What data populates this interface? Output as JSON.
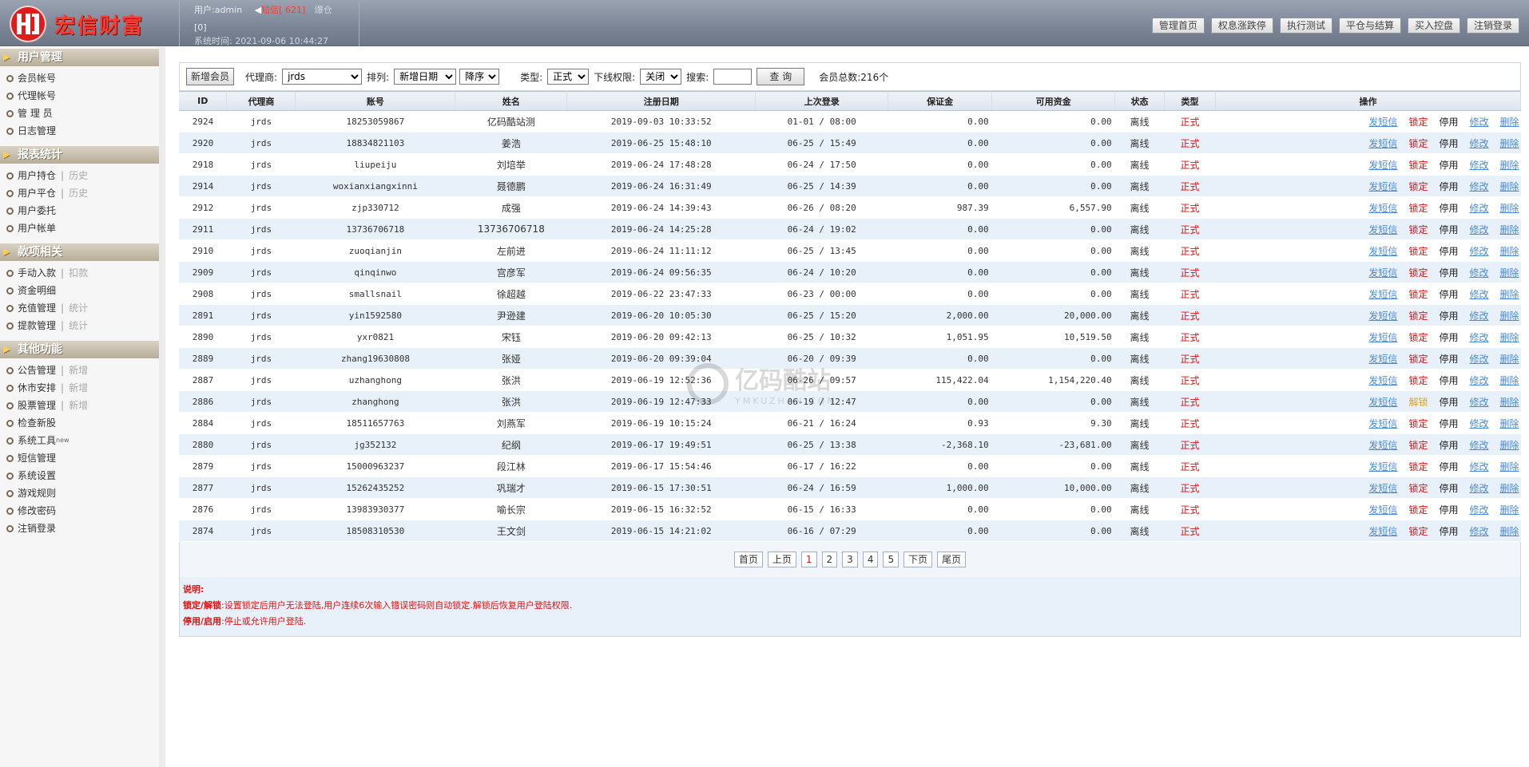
{
  "header": {
    "brand": "宏信财富",
    "user_label": "用户:admin",
    "sms_label": "短信[ 621]",
    "sms_extra": "爆仓",
    "bracket": "[0]",
    "time_label": "系统时间: 2021-09-06 10:44:27",
    "nav": [
      "管理首页",
      "权息涨跌停",
      "执行测试",
      "平仓与结算",
      "买入控盘",
      "注销登录"
    ]
  },
  "sidebar": {
    "sections": [
      {
        "title": "用户管理",
        "items": [
          {
            "label": "会员帐号"
          },
          {
            "label": "代理帐号"
          },
          {
            "label": "管 理 员"
          },
          {
            "label": "日志管理"
          }
        ]
      },
      {
        "title": "报表统计",
        "items": [
          {
            "label": "用户持仓",
            "sub": "历史"
          },
          {
            "label": "用户平仓",
            "sub": "历史"
          },
          {
            "label": "用户委托"
          },
          {
            "label": "用户帐单"
          }
        ]
      },
      {
        "title": "款项相关",
        "items": [
          {
            "label": "手动入款",
            "sub": "扣款"
          },
          {
            "label": "资金明细"
          },
          {
            "label": "充值管理",
            "sub": "统计"
          },
          {
            "label": "提款管理",
            "sub": "统计"
          }
        ]
      },
      {
        "title": "其他功能",
        "items": [
          {
            "label": "公告管理",
            "sub": "新增"
          },
          {
            "label": "休市安排",
            "sub": "新增"
          },
          {
            "label": "股票管理",
            "sub": "新增"
          },
          {
            "label": "检查新股"
          },
          {
            "label": "系统工具",
            "sup": "new"
          },
          {
            "label": "短信管理"
          },
          {
            "label": "系统设置"
          },
          {
            "label": "游戏规则"
          },
          {
            "label": "修改密码"
          },
          {
            "label": "注销登录"
          }
        ]
      }
    ]
  },
  "filters": {
    "add_button": "新增会员",
    "agent_label": "代理商:",
    "agent_value": "jrds",
    "sort_label": "排列:",
    "sort_value": "新增日期",
    "order_value": "降序",
    "type_label": "类型:",
    "type_value": "正式",
    "offline_label": "下线权限:",
    "offline_value": "关闭",
    "search_label": "搜索:",
    "search_value": "",
    "query_button": "查 询",
    "total": "会员总数:216个"
  },
  "table": {
    "headers": [
      "ID",
      "代理商",
      "账号",
      "姓名",
      "注册日期",
      "上次登录",
      "保证金",
      "可用资金",
      "状态",
      "类型",
      "操作"
    ],
    "ops": {
      "sms": "发短信",
      "lock": "锁定",
      "unlock": "解锁",
      "stop": "停用",
      "edit": "修改",
      "del": "删除"
    },
    "rows": [
      [
        "2924",
        "jrds",
        "18253059867",
        "亿码酷站测",
        "2019-09-03 10:33:52",
        "01-01 / 08:00",
        "0.00",
        "0.00",
        "离线",
        "正式",
        "lock"
      ],
      [
        "2920",
        "jrds",
        "18834821103",
        "姜浩",
        "2019-06-25 15:48:10",
        "06-25 / 15:49",
        "0.00",
        "0.00",
        "离线",
        "正式",
        "lock"
      ],
      [
        "2918",
        "jrds",
        "liupeiju",
        "刘培举",
        "2019-06-24 17:48:28",
        "06-24 / 17:50",
        "0.00",
        "0.00",
        "离线",
        "正式",
        "lock"
      ],
      [
        "2914",
        "jrds",
        "woxianxiangxinni",
        "聂德鹏",
        "2019-06-24 16:31:49",
        "06-25 / 14:39",
        "0.00",
        "0.00",
        "离线",
        "正式",
        "lock"
      ],
      [
        "2912",
        "jrds",
        "zjp330712",
        "成强",
        "2019-06-24 14:39:43",
        "06-26 / 08:20",
        "987.39",
        "6,557.90",
        "离线",
        "正式",
        "lock"
      ],
      [
        "2911",
        "jrds",
        "13736706718",
        "13736706718",
        "2019-06-24 14:25:28",
        "06-24 / 19:02",
        "0.00",
        "0.00",
        "离线",
        "正式",
        "lock"
      ],
      [
        "2910",
        "jrds",
        "zuoqianjin",
        "左前进",
        "2019-06-24 11:11:12",
        "06-25 / 13:45",
        "0.00",
        "0.00",
        "离线",
        "正式",
        "lock"
      ],
      [
        "2909",
        "jrds",
        "qinqinwo",
        "宫彦军",
        "2019-06-24 09:56:35",
        "06-24 / 10:20",
        "0.00",
        "0.00",
        "离线",
        "正式",
        "lock"
      ],
      [
        "2908",
        "jrds",
        "smallsnail",
        "徐超越",
        "2019-06-22 23:47:33",
        "06-23 / 00:00",
        "0.00",
        "0.00",
        "离线",
        "正式",
        "lock"
      ],
      [
        "2891",
        "jrds",
        "yin1592580",
        "尹逊建",
        "2019-06-20 10:05:30",
        "06-25 / 15:20",
        "2,000.00",
        "20,000.00",
        "离线",
        "正式",
        "lock"
      ],
      [
        "2890",
        "jrds",
        "yxr0821",
        "宋钰",
        "2019-06-20 09:42:13",
        "06-25 / 10:32",
        "1,051.95",
        "10,519.50",
        "离线",
        "正式",
        "lock"
      ],
      [
        "2889",
        "jrds",
        "zhang19630808",
        "张娅",
        "2019-06-20 09:39:04",
        "06-20 / 09:39",
        "0.00",
        "0.00",
        "离线",
        "正式",
        "lock"
      ],
      [
        "2887",
        "jrds",
        "uzhanghong",
        "张洪",
        "2019-06-19 12:52:36",
        "06-26 / 09:57",
        "115,422.04",
        "1,154,220.40",
        "离线",
        "正式",
        "lock"
      ],
      [
        "2886",
        "jrds",
        "zhanghong",
        "张洪",
        "2019-06-19 12:47:33",
        "06-19 / 12:47",
        "0.00",
        "0.00",
        "离线",
        "正式",
        "unlock"
      ],
      [
        "2884",
        "jrds",
        "18511657763",
        "刘燕军",
        "2019-06-19 10:15:24",
        "06-21 / 16:24",
        "0.93",
        "9.30",
        "离线",
        "正式",
        "lock"
      ],
      [
        "2880",
        "jrds",
        "jg352132",
        "纪纲",
        "2019-06-17 19:49:51",
        "06-25 / 13:38",
        "-2,368.10",
        "-23,681.00",
        "离线",
        "正式",
        "lock"
      ],
      [
        "2879",
        "jrds",
        "15000963237",
        "段江林",
        "2019-06-17 15:54:46",
        "06-17 / 16:22",
        "0.00",
        "0.00",
        "离线",
        "正式",
        "lock"
      ],
      [
        "2877",
        "jrds",
        "15262435252",
        "巩瑞才",
        "2019-06-15 17:30:51",
        "06-24 / 16:59",
        "1,000.00",
        "10,000.00",
        "离线",
        "正式",
        "lock"
      ],
      [
        "2876",
        "jrds",
        "13983930377",
        "喻长宗",
        "2019-06-15 16:32:52",
        "06-15 / 16:33",
        "0.00",
        "0.00",
        "离线",
        "正式",
        "lock"
      ],
      [
        "2874",
        "jrds",
        "18508310530",
        "王文剑",
        "2019-06-15 14:21:02",
        "06-16 / 07:29",
        "0.00",
        "0.00",
        "离线",
        "正式",
        "lock"
      ]
    ]
  },
  "pager": {
    "first": "首页",
    "prev": "上页",
    "pages": [
      "1",
      "2",
      "3",
      "4",
      "5"
    ],
    "current": "1",
    "next": "下页",
    "last": "尾页"
  },
  "notes": {
    "title": "说明:",
    "lock_key": "锁定/解锁",
    "lock_text": ":设置锁定后用户无法登陆,用户连续6次输入错误密码则自动锁定.解锁后恢复用户登陆权限.",
    "stop_key": "停用/启用",
    "stop_text": ":停止或允许用户登陆."
  },
  "watermark": {
    "big": "亿码酷站",
    "small": "YMKUZHAN.COM"
  },
  "colors": {
    "accent_red": "#e01010",
    "link_blue": "#4a8bd6",
    "row_alt": "#e8f0f9",
    "header_bg": "#7b8596"
  }
}
